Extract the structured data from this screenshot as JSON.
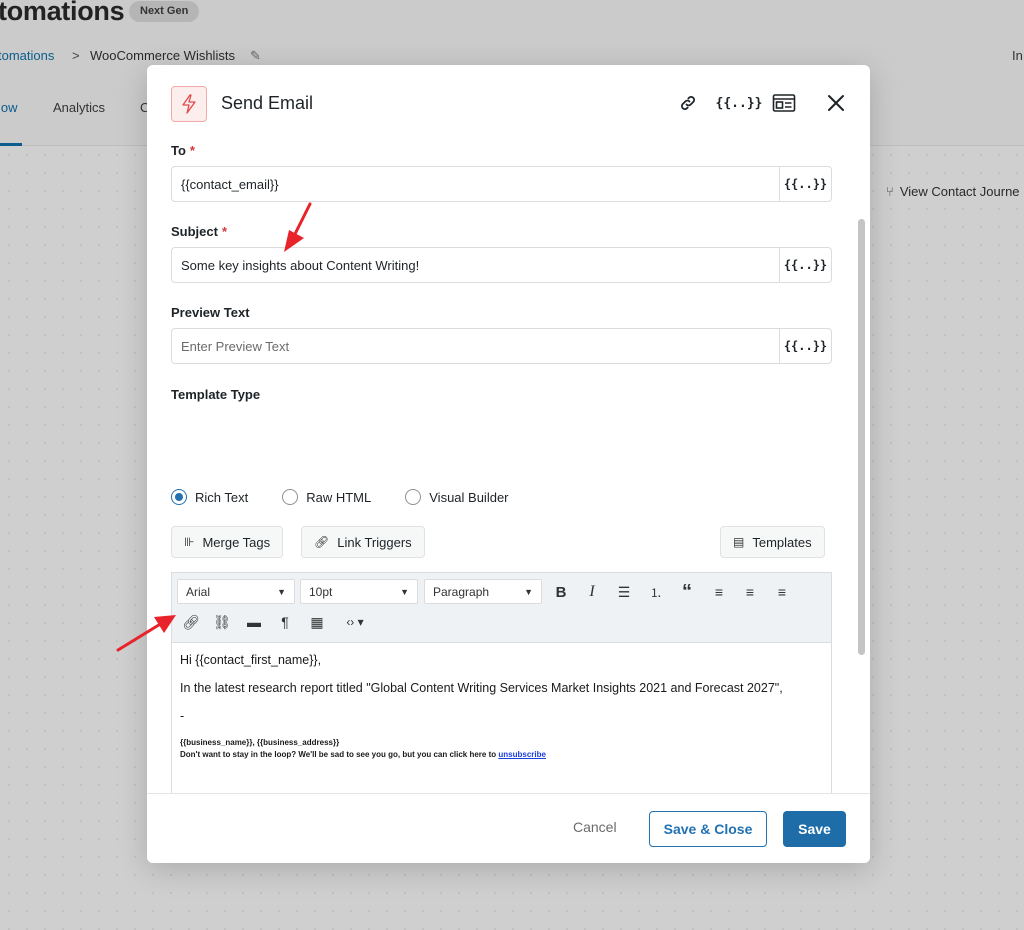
{
  "background": {
    "title": "tomations",
    "badge": "Next Gen",
    "breadcrumb_link": "tomations",
    "breadcrumb_sep": ">",
    "breadcrumb_current": "WooCommerce Wishlists",
    "right_text": "In",
    "tabs": {
      "active": "low",
      "analytics": "Analytics",
      "partial": "C"
    },
    "view_journey": "View Contact Journe"
  },
  "modal": {
    "title": "Send Email",
    "to": {
      "label": "To",
      "required": "*",
      "value": "{{contact_email}}"
    },
    "subject": {
      "label": "Subject",
      "required": "*",
      "value": "Some key insights about Content Writing!"
    },
    "preview": {
      "label": "Preview Text",
      "placeholder": "Enter Preview Text"
    },
    "merge_tag_symbol": "{{..}}",
    "template_type": {
      "label": "Template Type",
      "options": [
        "Rich Text",
        "Raw HTML",
        "Visual Builder"
      ],
      "selected": "Rich Text"
    },
    "tools": {
      "merge_tags": "Merge Tags",
      "link_triggers": "Link Triggers",
      "templates": "Templates"
    },
    "editor": {
      "font": "Arial",
      "size": "10pt",
      "block": "Paragraph",
      "line1": "Hi {{contact_first_name}},",
      "line2": "In the latest research report titled \"Global Content Writing Services Market Insights 2021 and Forecast 2027\",",
      "line3": "-",
      "footer_line1": "{{business_name}}, {{business_address}}",
      "footer_line2": "Don't want to stay in the loop? We'll be sad to see you go, but you can click here to",
      "unsubscribe": "unsubscribe"
    },
    "footer": {
      "cancel": "Cancel",
      "save_close": "Save & Close",
      "save": "Save"
    }
  },
  "colors": {
    "accent": "#2271b1",
    "danger": "#d63638",
    "annotation": "#e8232a"
  }
}
